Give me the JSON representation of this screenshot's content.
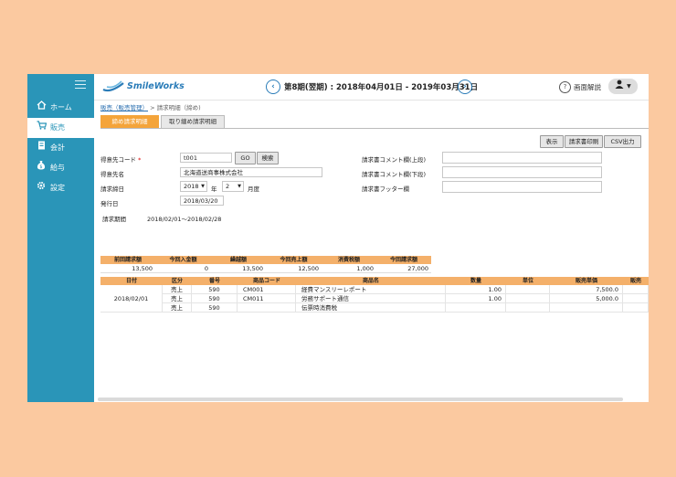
{
  "app": {
    "name": "SmileWorks"
  },
  "sidebar": {
    "items": [
      {
        "label": "ホーム",
        "icon": "home-icon"
      },
      {
        "label": "販売",
        "icon": "cart-icon"
      },
      {
        "label": "会計",
        "icon": "ledger-icon"
      },
      {
        "label": "給与",
        "icon": "money-bag-icon"
      },
      {
        "label": "設定",
        "icon": "gear-icon"
      }
    ],
    "active_index": 1
  },
  "header": {
    "period": "第8期(翌期) : 2018年04月01日 - 2019年03月31日",
    "help_label": "画面解説"
  },
  "breadcrumb": {
    "parent": "販売（販売管理）",
    "current": "> 請求明細（締め)"
  },
  "tabs": [
    "締め請求明細",
    "取り纏め請求明細"
  ],
  "toolbar": {
    "display": "表示",
    "print": "請求書印刷",
    "csv": "CSV出力"
  },
  "form": {
    "customer_code_label": "得意先コード",
    "customer_code_required": "*",
    "customer_code_value": "t001",
    "go_button": "GO",
    "search_button": "検索",
    "customer_name_label": "得意先名",
    "customer_name_value": "北海道送商事株式会社",
    "closing_label": "請求締日",
    "year_value": "2018",
    "year_suffix": "年",
    "month_value": "2",
    "month_suffix": "月度",
    "issue_label": "発行日",
    "issue_value": "2018/03/20",
    "period_label": "請求期間",
    "period_value": "2018/02/01〜2018/02/28",
    "comment_upper_label": "請求書コメント欄(上段)",
    "comment_lower_label": "請求書コメント欄(下段)",
    "footer_label": "請求書フッター欄"
  },
  "summary": {
    "headers": [
      "前回請求額",
      "今回入金額",
      "繰越額",
      "今回売上額",
      "消費税額",
      "今回請求額"
    ],
    "values": [
      "13,500",
      "0",
      "13,500",
      "12,500",
      "1,000",
      "27,000"
    ]
  },
  "details": {
    "headers": [
      "日付",
      "区分",
      "番号",
      "商品コード",
      "商品名",
      "数量",
      "単位",
      "販売単価",
      "販売"
    ],
    "date": "2018/02/01",
    "rows": [
      {
        "kubun": "売上",
        "num": "590",
        "code": "CM001",
        "name": "経費マンスリーレポート",
        "qty": "1.00",
        "unit": "",
        "price": "7,500.0"
      },
      {
        "kubun": "売上",
        "num": "590",
        "code": "CM011",
        "name": "労務サポート通信",
        "qty": "1.00",
        "unit": "",
        "price": "5,000.0"
      },
      {
        "kubun": "売上",
        "num": "590",
        "code": "",
        "name": "伝票時消費税",
        "qty": "",
        "unit": "",
        "price": ""
      }
    ]
  }
}
